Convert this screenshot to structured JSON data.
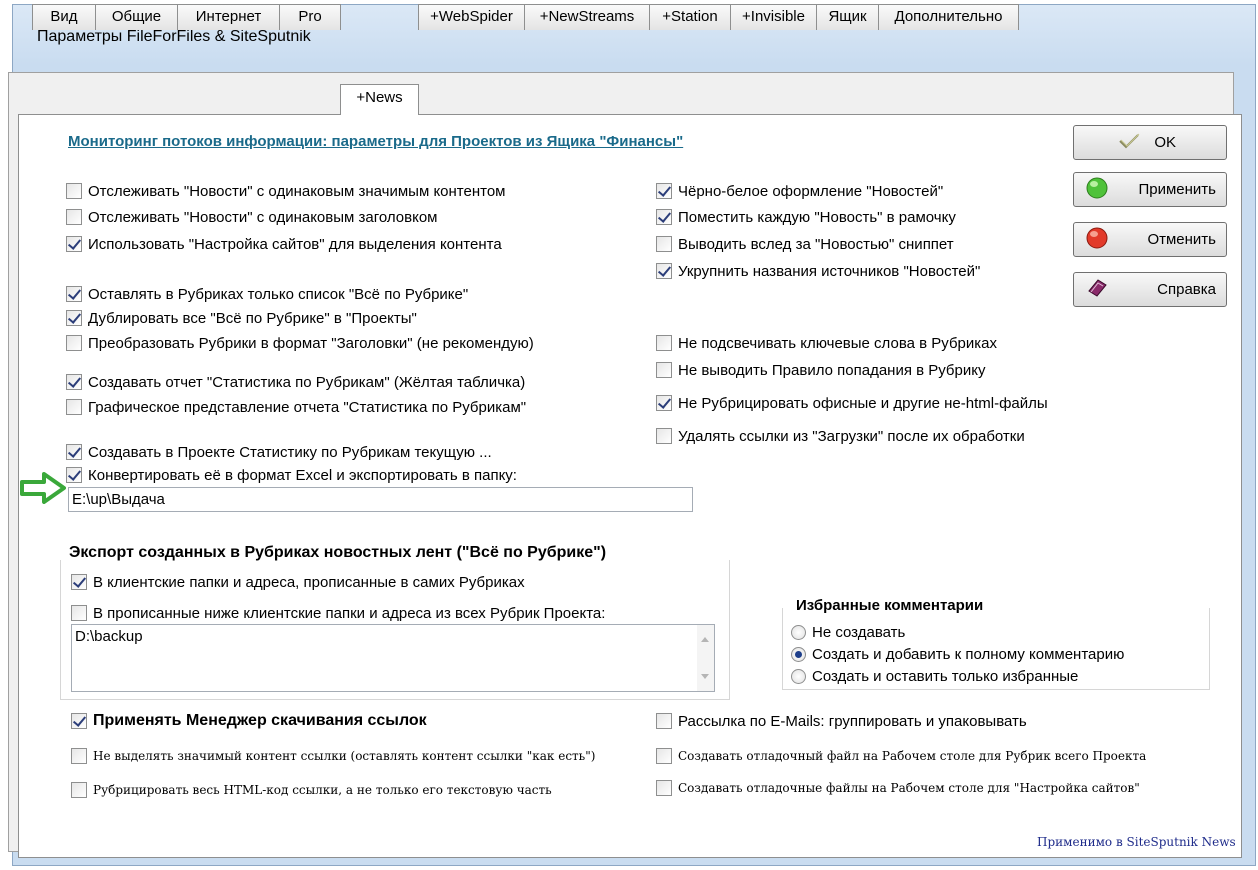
{
  "window": {
    "title": "Параметры FileForFiles & SiteSputnik"
  },
  "tabs": [
    {
      "label": "Вид"
    },
    {
      "label": "Общие"
    },
    {
      "label": "Интернет"
    },
    {
      "label": "Pro"
    },
    {
      "label": "+News"
    },
    {
      "label": "+WebSpider"
    },
    {
      "label": "+NewStreams"
    },
    {
      "label": "+Station"
    },
    {
      "label": "+Invisible"
    },
    {
      "label": "Ящик"
    },
    {
      "label": "Дополнительно"
    }
  ],
  "active_tab": "+News",
  "heading": "Мониторинг потоков информации: параметры для Проектов из Ящика \"Финансы\"",
  "buttons": {
    "ok": "OK",
    "apply": "Применить",
    "cancel": "Отменить",
    "help": "Справка"
  },
  "left": [
    {
      "label": "Отслеживать \"Новости\" с одинаковым значимым контентом",
      "checked": false
    },
    {
      "label": "Отслеживать \"Новости\" с одинаковым заголовком",
      "checked": false
    },
    {
      "label": "Использовать \"Настройка сайтов\" для выделения контента",
      "checked": true
    },
    {
      "label": "Оставлять в Рубриках только список \"Всё по Рубрике\"",
      "checked": true
    },
    {
      "label": "Дублировать все  \"Всё по Рубрике\" в \"Проекты\"",
      "checked": true
    },
    {
      "label": "Преобразовать Рубрики в формат \"Заголовки\" (не рекомендую)",
      "checked": false
    },
    {
      "label": "Создавать отчет \"Статистика по Рубрикам\" (Жёлтая табличка)",
      "checked": true
    },
    {
      "label": "Графическое представление отчета \"Статистика по Рубрикам\"",
      "checked": false
    },
    {
      "label": "Создавать в Проекте Статистику по Рубрикам текущую ...",
      "checked": true
    },
    {
      "label": "Конвертировать её в формат Excel и экспортировать в папку:",
      "checked": true
    }
  ],
  "right": [
    {
      "label": "Чёрно-белое оформление \"Новостей\"",
      "checked": true
    },
    {
      "label": "Поместить каждую \"Новость\" в рамочку",
      "checked": true
    },
    {
      "label": "Выводить вслед за \"Новостью\" сниппет",
      "checked": false
    },
    {
      "label": "Укрупнить названия источников \"Новостей\"",
      "checked": true
    },
    {
      "label": "Не подсвечивать ключевые слова в Рубриках",
      "checked": false
    },
    {
      "label": "Не выводить Правило попадания в Рубрику",
      "checked": false
    },
    {
      "label": "Не Рубрицировать офисные и другие не-html-файлы",
      "checked": true
    },
    {
      "label": "Удалять ссылки  из \"Загрузки\" после их обработки",
      "checked": false
    }
  ],
  "export_path": "E:\\up\\Выдача",
  "export_group": {
    "title": "Экспорт созданных в Рубриках новостных лент (\"Всё по Рубрике\")",
    "opt1": {
      "label": "В клиентские папки и адреса, прописанные в самих Рубриках",
      "checked": true
    },
    "opt2": {
      "label": "В прописанные  ниже клиентские папки и адреса из всех Рубрик Проекта:",
      "checked": false
    },
    "textarea": "D:\\backup"
  },
  "favorites": {
    "title": "Избранные комментарии",
    "options": [
      {
        "label": "Не создавать",
        "selected": false
      },
      {
        "label": "Создать и добавить к полному комментарию",
        "selected": true
      },
      {
        "label": "Создать и оставить только избранные",
        "selected": false
      }
    ]
  },
  "download_manager": {
    "main": {
      "label": "Применять Менеджер скачивания ссылок",
      "checked": true
    },
    "sub1": {
      "label": "Не выделять значимый контент ссылки (оставлять контент ссылки \"как есть\")",
      "checked": false
    },
    "sub2": {
      "label": "Рубрицировать весь HTML-код ссылки, а не только его текстовую часть",
      "checked": false
    }
  },
  "bottom_right": [
    {
      "label": "Рассылка по E-Mails: группировать и упаковывать",
      "checked": false
    },
    {
      "label": "Создавать отладочный файл на Рабочем столе для Рубрик всего Проекта",
      "checked": false
    },
    {
      "label": "Создавать отладочные файлы на Рабочем столе для \"Настройка сайтов\"",
      "checked": false
    }
  ],
  "footer": "Применимо в SiteSputnik News",
  "colors": {
    "heading": "#1a6a8a",
    "arrow": "#3aa83a",
    "footer": "#1e2b8a"
  }
}
